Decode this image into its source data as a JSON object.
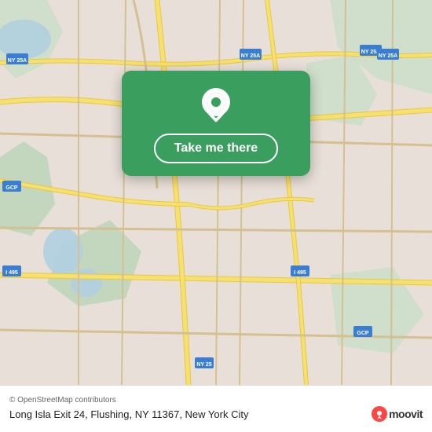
{
  "map": {
    "alt": "Map of Flushing, NY area"
  },
  "card": {
    "button_label": "Take me there"
  },
  "bottom_bar": {
    "attribution": "© OpenStreetMap contributors",
    "address": "Long Isla Exit 24, Flushing, NY 11367, New York City",
    "moovit_label": "moovit"
  },
  "icons": {
    "pin": "location-pin-icon",
    "moovit_dot": "moovit-brand-icon"
  }
}
